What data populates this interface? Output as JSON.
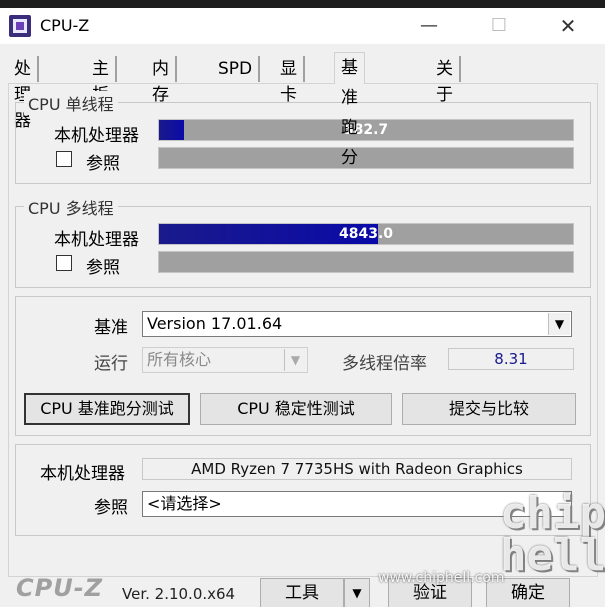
{
  "window": {
    "title": "CPU-Z"
  },
  "controls": {
    "minimize": "—",
    "maximize": "☐",
    "close": "✕"
  },
  "tabs": [
    {
      "label": "处理器"
    },
    {
      "label": "主板"
    },
    {
      "label": "内存"
    },
    {
      "label": "SPD"
    },
    {
      "label": "显卡"
    },
    {
      "label": "基准跑分",
      "active": true
    },
    {
      "label": "关于"
    }
  ],
  "single_thread": {
    "title": "CPU 单线程",
    "this_cpu_label": "本机处理器",
    "this_cpu_value": "582.7",
    "this_cpu_fill": 0.06,
    "reference_label": "参照",
    "reference_fill": 0
  },
  "multi_thread": {
    "title": "CPU 多线程",
    "this_cpu_label": "本机处理器",
    "this_cpu_value": "4843.0",
    "this_cpu_fill": 0.53,
    "reference_label": "参照",
    "reference_fill": 0
  },
  "settings": {
    "benchmark_label": "基准",
    "benchmark_value": "Version 17.01.64",
    "run_label": "运行",
    "run_value": "所有核心",
    "ratio_label": "多线程倍率",
    "ratio_value": "8.31"
  },
  "buttons": {
    "bench": "CPU 基准跑分测试",
    "stress": "CPU 稳定性测试",
    "submit": "提交与比较"
  },
  "cpu_info": {
    "this_cpu_label": "本机处理器",
    "this_cpu_name": "AMD Ryzen 7 7735HS with Radeon Graphics",
    "reference_label": "参照",
    "reference_value": "<请选择>"
  },
  "footer": {
    "logo": "CPU-Z",
    "version": "Ver. 2.10.0.x64",
    "tools": "工具",
    "tools_arrow": "▼",
    "validate": "验证",
    "ok": "确定"
  },
  "watermark": {
    "logo": "chip hell",
    "url": "www.chiphell.com"
  },
  "colors": {
    "accent": "#1a1a8c",
    "bar_bg": "#a0a0a0"
  }
}
